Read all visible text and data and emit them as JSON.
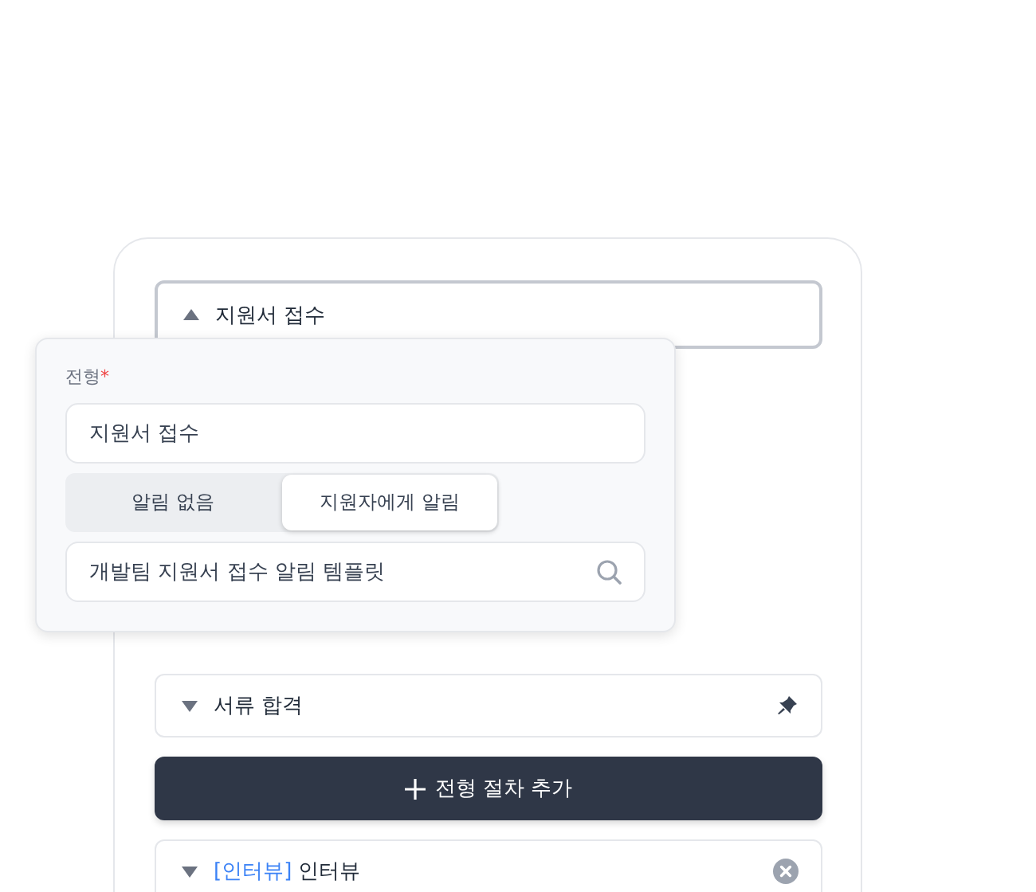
{
  "stages": [
    {
      "title": "지원서 접수",
      "expanded": true,
      "kind": "plain"
    },
    {
      "title": "서류 합격",
      "expanded": false,
      "kind": "pinned"
    },
    {
      "tag": "[인터뷰]",
      "title": "인터뷰",
      "expanded": false,
      "kind": "removable"
    }
  ],
  "add_button": {
    "label": "전형 절차 추가"
  },
  "editor": {
    "label": "전형",
    "required_mark": "*",
    "name_value": "지원서 접수",
    "notify_options": [
      {
        "label": "알림 없음",
        "selected": false
      },
      {
        "label": "지원자에게 알림",
        "selected": true
      }
    ],
    "template_value": "개발팀 지원서 접수 알림 템플릿"
  }
}
